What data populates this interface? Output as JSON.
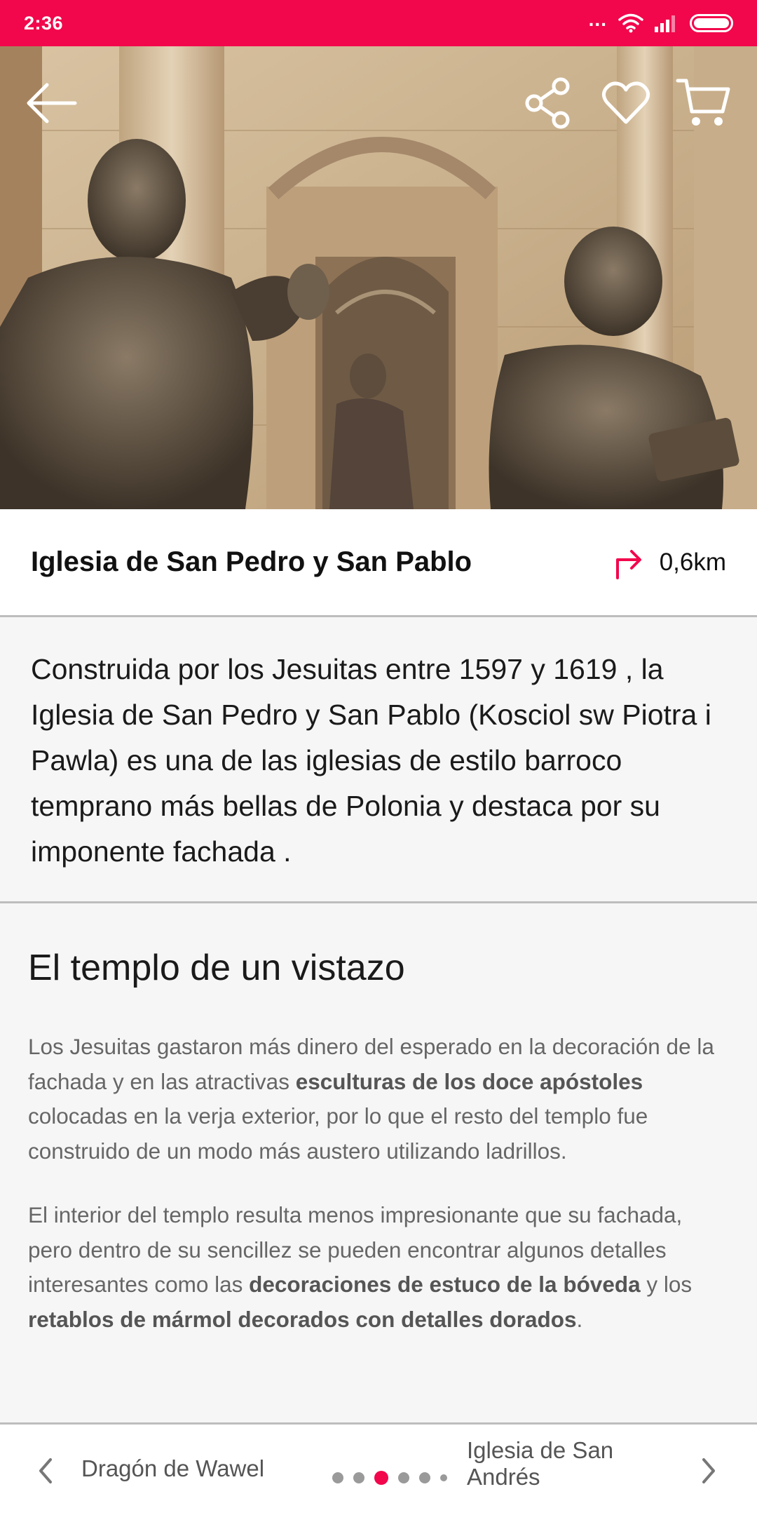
{
  "status_bar": {
    "time": "2:36",
    "dots": "...",
    "icons": [
      "wifi-icon",
      "signal-icon",
      "battery-icon"
    ]
  },
  "hero": {
    "icons": [
      "back-arrow-icon",
      "share-icon",
      "heart-icon",
      "cart-icon"
    ]
  },
  "title": "Iglesia de San Pedro y San Pablo",
  "distance": {
    "icon": "turn-right-arrow-icon",
    "value": "0,6km"
  },
  "intro": "Construida por los Jesuitas entre  1597 y 1619 , la Iglesia de San Pedro y San Pablo (Kosciol sw Piotra i Pawla) es una de las iglesias de estilo barroco temprano más bellas de Polonia y destaca por su imponente fachada .",
  "section": {
    "heading": "El templo de un vistazo",
    "p1": {
      "a": "Los Jesuitas gastaron más dinero del esperado en la decoración de la fachada y en las atractivas ",
      "b": "esculturas de los doce apóstoles",
      "c": " colocadas en la verja exterior, por lo que el resto del templo fue construido de un modo más austero utilizando ladrillos."
    },
    "p2": {
      "a": "El interior del templo resulta menos impresionante que su fachada, pero dentro de su sencillez se pueden encontrar algunos detalles interesantes como las ",
      "b": "decoraciones de estuco de la bóveda",
      "c": " y los ",
      "d": "retablos de mármol decorados con detalles dorados",
      "e": "."
    }
  },
  "nav": {
    "prev": "Dragón de Wawel",
    "next": "Iglesia de San Andrés",
    "current_index": 3,
    "total": 6
  },
  "colors": {
    "accent": "#f2074c"
  }
}
